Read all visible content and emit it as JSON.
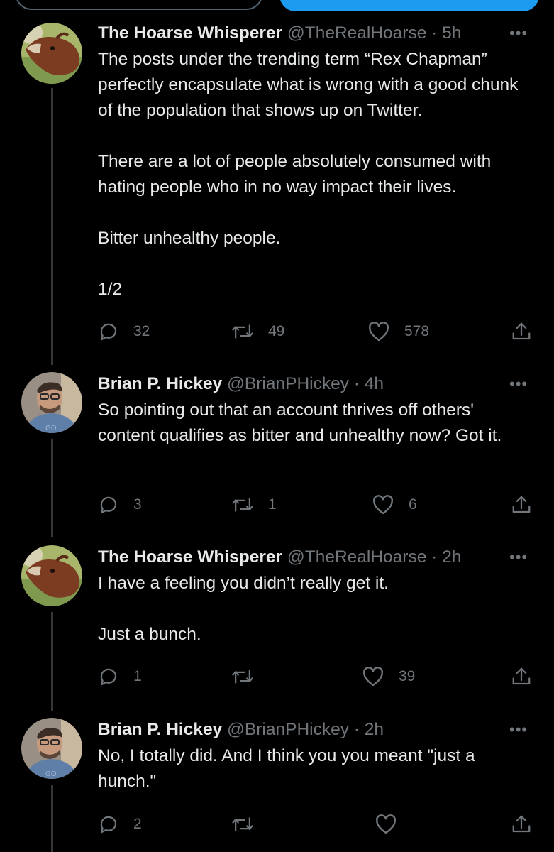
{
  "thread": [
    {
      "author": "The Hoarse Whisperer",
      "handle": "@TheRealHoarse",
      "time": "5h",
      "paragraphs": [
        "The posts under the trending term “Rex Chapman” perfectly encapsulate what is wrong with a good chunk of the population that shows up on Twitter.",
        "There are a lot of people absolutely consumed with hating people who in no way impact their lives.",
        "Bitter unhealthy people.",
        "1/2"
      ],
      "replies": "32",
      "retweets": "49",
      "likes": "578"
    },
    {
      "author": "Brian P. Hickey",
      "handle": "@BrianPHickey",
      "time": "4h",
      "paragraphs": [
        "So pointing out that an account thrives off others' content qualifies as bitter and unhealthy now? Got it."
      ],
      "replies": "3",
      "retweets": "1",
      "likes": "6"
    },
    {
      "author": "The Hoarse Whisperer",
      "handle": "@TheRealHoarse",
      "time": "2h",
      "paragraphs": [
        "I have a feeling you didn’t really get it.",
        "Just a bunch."
      ],
      "replies": "1",
      "retweets": "",
      "likes": "39"
    },
    {
      "author": "Brian P. Hickey",
      "handle": "@BrianPHickey",
      "time": "2h",
      "paragraphs": [
        "No, I totally did. And I think you you meant \"just a hunch.\""
      ],
      "replies": "2",
      "retweets": "",
      "likes": ""
    }
  ],
  "separator": "·",
  "more_glyph": "•••",
  "icons": {
    "reply": "reply-icon",
    "retweet": "retweet-icon",
    "like": "like-icon",
    "share": "share-icon",
    "more": "more-icon"
  },
  "colors": {
    "background": "#000000",
    "text": "#e7e9ea",
    "secondary": "#71767b",
    "accent": "#1d9bf0",
    "thread_line": "#333639"
  }
}
